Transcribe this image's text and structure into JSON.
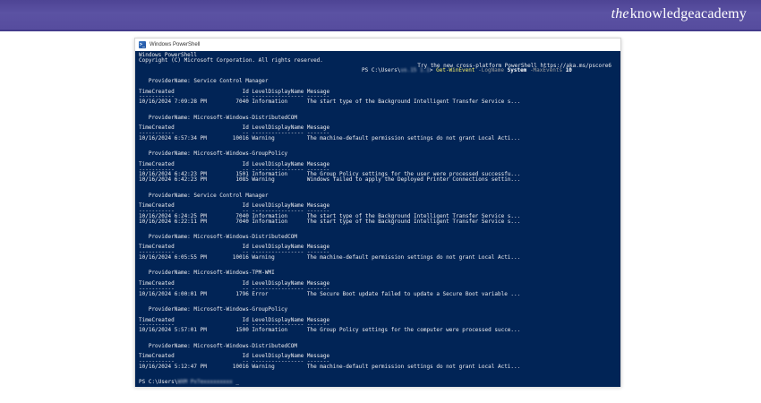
{
  "brand": {
    "logo_the": "the",
    "logo_rest": "knowledgeacademy",
    "header_color": "#56509e"
  },
  "terminal": {
    "title": "Windows PowerShell",
    "background_color": "#012456",
    "banner_line1": "Windows PowerShell",
    "banner_line2": "Copyright (C) Microsoft Corporation. All rights reserved.",
    "update_notice": "Try the new cross-platform PowerShell https://aka.ms/pscore6",
    "prompt": {
      "prefix": "PS C:\\Users\\",
      "redacted_user": "us.15 1.1",
      "separator": "> ",
      "command": "Get-WinEvent",
      "param1": "-LogName",
      "value1": "System",
      "param2": "-MaxEvents",
      "value2": "10",
      "command_color": "#f9f06b",
      "param_color": "#9a9a9a"
    },
    "log": {
      "provider_label": "ProviderName:",
      "columns": [
        "TimeCreated",
        "Id",
        "LevelDisplayName",
        "Message"
      ],
      "sections": [
        {
          "provider": "Service Control Manager",
          "events": [
            {
              "time": "10/16/2024 7:09:28 PM",
              "id": "7040",
              "level": "Information",
              "message": "The start type of the Background Intelligent Transfer Service s..."
            }
          ]
        },
        {
          "provider": "Microsoft-Windows-DistributedCOM",
          "events": [
            {
              "time": "10/16/2024 6:57:34 PM",
              "id": "10016",
              "level": "Warning",
              "message": "The machine-default permission settings do not grant Local Acti..."
            }
          ]
        },
        {
          "provider": "Microsoft-Windows-GroupPolicy",
          "events": [
            {
              "time": "10/16/2024 6:42:23 PM",
              "id": "1501",
              "level": "Information",
              "message": "The Group Policy settings for the user were processed successfu..."
            },
            {
              "time": "10/16/2024 6:42:23 PM",
              "id": "1085",
              "level": "Warning",
              "message": "Windows failed to apply the Deployed Printer Connections settin..."
            }
          ]
        },
        {
          "provider": "Service Control Manager",
          "events": [
            {
              "time": "10/16/2024 6:24:25 PM",
              "id": "7040",
              "level": "Information",
              "message": "The start type of the Background Intelligent Transfer Service s..."
            },
            {
              "time": "10/16/2024 6:22:11 PM",
              "id": "7040",
              "level": "Information",
              "message": "The start type of the Background Intelligent Transfer Service s..."
            }
          ]
        },
        {
          "provider": "Microsoft-Windows-DistributedCOM",
          "events": [
            {
              "time": "10/16/2024 6:05:55 PM",
              "id": "10016",
              "level": "Warning",
              "message": "The machine-default permission settings do not grant Local Acti..."
            }
          ]
        },
        {
          "provider": "Microsoft-Windows-TPM-WMI",
          "events": [
            {
              "time": "10/16/2024 6:00:01 PM",
              "id": "1796",
              "level": "Error",
              "message": "The Secure Boot update failed to update a Secure Boot variable ..."
            }
          ]
        },
        {
          "provider": "Microsoft-Windows-GroupPolicy",
          "events": [
            {
              "time": "10/16/2024 5:57:01 PM",
              "id": "1500",
              "level": "Information",
              "message": "The Group Policy settings for the computer were processed succe..."
            }
          ]
        },
        {
          "provider": "Microsoft-Windows-DistributedCOM",
          "events": [
            {
              "time": "10/16/2024 5:12:47 PM",
              "id": "10016",
              "level": "Warning",
              "message": "The machine-default permission settings do not grant Local Acti..."
            }
          ]
        }
      ]
    },
    "final_prompt": {
      "prefix": "PS C:\\Users\\",
      "redacted": "WXM PxTexxxxxxxxx",
      "cursor": "_"
    }
  }
}
